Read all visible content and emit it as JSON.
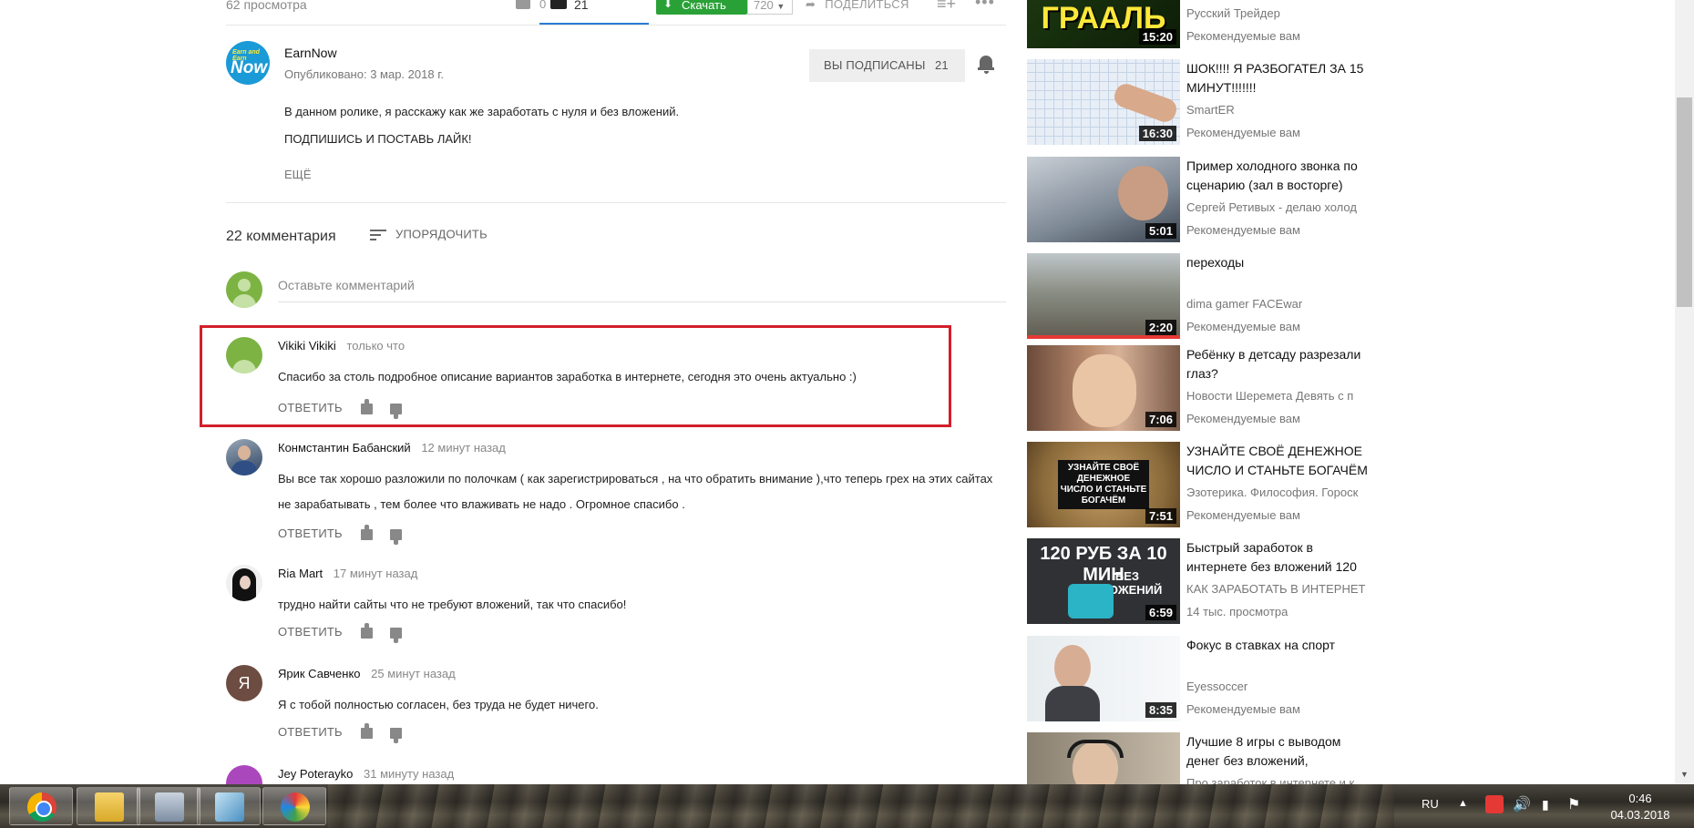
{
  "video_bar": {
    "views": "62 просмотра",
    "likes": "21",
    "dislikes": "0",
    "download_label": "Скачать",
    "quality": "720",
    "share_label": "ПОДЕЛИТЬСЯ"
  },
  "channel": {
    "logo_line1": "Earn and Earn",
    "logo_line2": "Now",
    "name": "EarnNow",
    "published": "Опубликовано: 3 мар. 2018 г.",
    "subscribed_label": "ВЫ ПОДПИСАНЫ",
    "subscriber_count": "21"
  },
  "description": {
    "line1": "В данном ролике, я расскажу как же заработать с нуля и без вложений.",
    "line2": "ПОДПИШИСЬ И ПОСТАВЬ ЛАЙК!",
    "show_more": "ЕЩЁ"
  },
  "comments_header": {
    "count": "22 комментария",
    "sort_label": "УПОРЯДОЧИТЬ",
    "placeholder": "Оставьте комментарий"
  },
  "comments": [
    {
      "author": "Vikiki Vikiki",
      "time": "только что",
      "text": "Спасибо за столь подробное описание вариантов заработка в интернете, сегодня это очень актуально :)",
      "reply": "ОТВЕТИТЬ"
    },
    {
      "author": "Конмстантин Бабанский",
      "time": "12 минут назад",
      "text": "Вы все так хорошо разложили по полочкам ( как зарегистрироваться , на что обратить внимание ),что теперь грех на этих сайтах не зарабатывать , тем более что влаживать не надо . Огромное спасибо .",
      "reply": "ОТВЕТИТЬ"
    },
    {
      "author": "Ria Mart",
      "time": "17 минут назад",
      "text": "трудно найти сайты что не требуют вложений, так что спасибо!",
      "reply": "ОТВЕТИТЬ"
    },
    {
      "author": "Ярик Савченко",
      "avatar_letter": "Я",
      "time": "25 минут назад",
      "text": "Я с тобой полностью согласен, без труда не будет ничего.",
      "reply": "ОТВЕТИТЬ"
    },
    {
      "author": "Jey Poterayko",
      "time": "31 минуту назад"
    }
  ],
  "sidebar": [
    {
      "title": "",
      "overlay": "ГРААЛЬ",
      "channel": "Русский Трейдер",
      "meta": "Рекомендуемые вам",
      "duration": "15:20"
    },
    {
      "title": "ШОК!!!! Я РАЗБОГАТЕЛ ЗА 15 МИНУТ!!!!!!!",
      "channel": "SmartER",
      "meta": "Рекомендуемые вам",
      "duration": "16:30"
    },
    {
      "title": "Пример холодного звонка по сценарию (зал в восторге)",
      "channel": "Сергей Ретивых - делаю холод",
      "meta": "Рекомендуемые вам",
      "duration": "5:01"
    },
    {
      "title": "переходы",
      "channel": "dima gamer FACEwar",
      "meta": "Рекомендуемые вам",
      "duration": "2:20"
    },
    {
      "title": "Ребёнку в детсаду разрезали глаз?",
      "channel": "Новости Шеремета Девять с п",
      "meta": "Рекомендуемые вам",
      "duration": "7:06"
    },
    {
      "title": "УЗНАЙТЕ СВОЁ ДЕНЕЖНОЕ ЧИСЛО И СТАНЬТЕ БОГАЧЁМ",
      "overlay": "УЗНАЙТЕ СВОЁ ДЕНЕЖНОЕ ЧИСЛО И СТАНЬТЕ БОГАЧЁМ",
      "channel": "Эзотерика. Философия. Гороск",
      "meta": "Рекомендуемые вам",
      "duration": "7:51"
    },
    {
      "title": "Быстрый заработок в интернете без вложений 120",
      "overlay": "120 РУБ ЗА 10 МИН",
      "overlay2": "БЕЗ ВЛОЖЕНИЙ",
      "channel": "КАК ЗАРАБОТАТЬ В ИНТЕРНЕТ",
      "meta": "14 тыс. просмотра",
      "duration": "6:59"
    },
    {
      "title": "Фокус в ставках на спорт",
      "channel": "Eyessoccer",
      "meta": "Рекомендуемые вам",
      "duration": "8:35"
    },
    {
      "title": "Лучшие 8 игры с выводом денег без вложений,",
      "channel": "Про заработок в интернете и к",
      "meta": "",
      "duration": ""
    }
  ],
  "taskbar": {
    "lang": "RU",
    "time": "0:46",
    "date": "04.03.2018"
  },
  "colors": {
    "highlight_border": "#d21f2b",
    "download_green": "#2aa137",
    "like_underline": "#2b7cd3"
  }
}
